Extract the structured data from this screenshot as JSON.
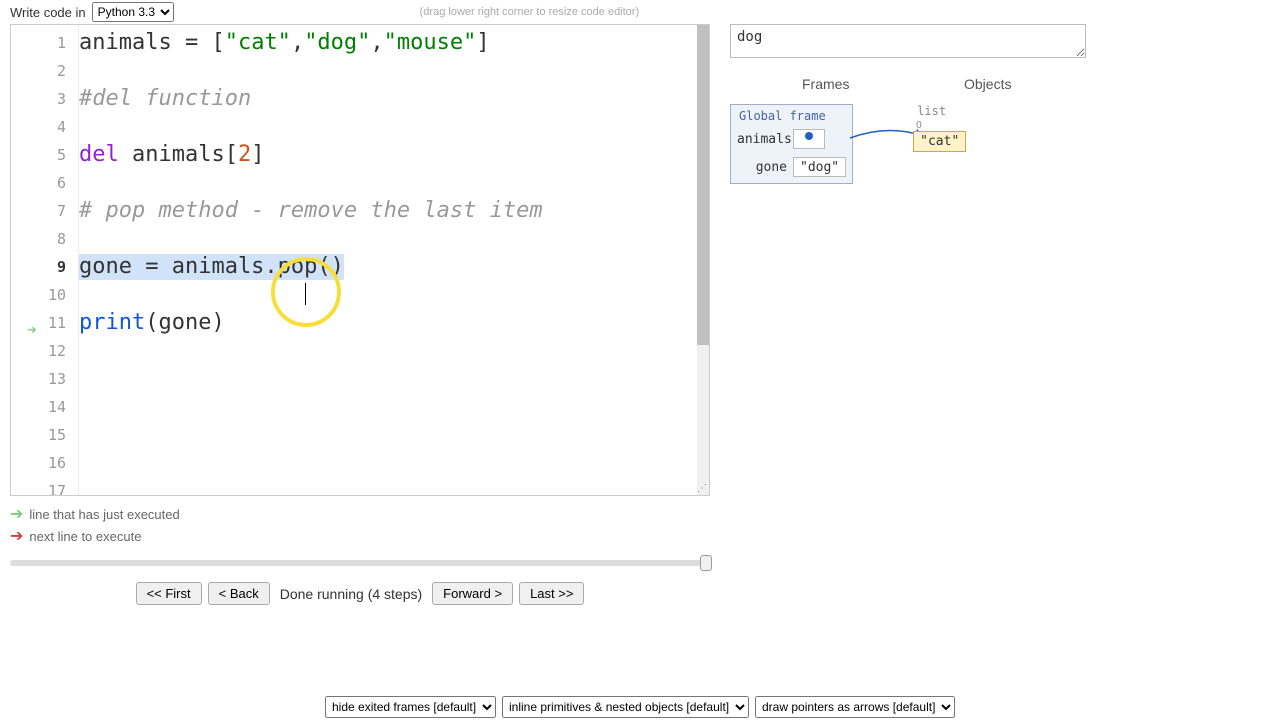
{
  "topbar": {
    "write_label": "Write code in",
    "lang": "Python 3.3",
    "resize_hint": "(drag lower right corner to resize code editor)"
  },
  "code": {
    "lines": [
      {
        "n": 1,
        "tokens": [
          {
            "t": "animals = [",
            "c": ""
          },
          {
            "t": "\"cat\"",
            "c": "str"
          },
          {
            "t": ",",
            "c": ""
          },
          {
            "t": "\"dog\"",
            "c": "str"
          },
          {
            "t": ",",
            "c": ""
          },
          {
            "t": "\"mouse\"",
            "c": "str"
          },
          {
            "t": "]",
            "c": ""
          }
        ]
      },
      {
        "n": 2,
        "tokens": []
      },
      {
        "n": 3,
        "tokens": [
          {
            "t": "#del function",
            "c": "comment"
          }
        ]
      },
      {
        "n": 4,
        "tokens": []
      },
      {
        "n": 5,
        "tokens": [
          {
            "t": "del",
            "c": "kw"
          },
          {
            "t": " animals[",
            "c": ""
          },
          {
            "t": "2",
            "c": "num"
          },
          {
            "t": "]",
            "c": ""
          }
        ]
      },
      {
        "n": 6,
        "tokens": []
      },
      {
        "n": 7,
        "tokens": [
          {
            "t": "# pop method - remove the last item",
            "c": "comment"
          }
        ]
      },
      {
        "n": 8,
        "tokens": []
      },
      {
        "n": 9,
        "tokens": [
          {
            "t": "gone = animals.pop()",
            "c": ""
          }
        ]
      },
      {
        "n": 10,
        "tokens": []
      },
      {
        "n": 11,
        "tokens": [
          {
            "t": "print",
            "c": "builtin"
          },
          {
            "t": "(gone)",
            "c": ""
          }
        ]
      },
      {
        "n": 12,
        "tokens": []
      },
      {
        "n": 13,
        "tokens": []
      },
      {
        "n": 14,
        "tokens": []
      },
      {
        "n": 15,
        "tokens": []
      },
      {
        "n": 16,
        "tokens": []
      },
      {
        "n": 17,
        "tokens": []
      }
    ],
    "highlighted_line": 9,
    "exec_arrow_line": 11
  },
  "legend": {
    "just": "line that has just executed",
    "next": "next line to execute"
  },
  "controls": {
    "first": "<< First",
    "back": "< Back",
    "status": "Done running (4 steps)",
    "forward": "Forward >",
    "last": "Last >>"
  },
  "output": "dog",
  "viz": {
    "frames_label": "Frames",
    "objects_label": "Objects",
    "global_frame": "Global frame",
    "var_animals": "animals",
    "var_gone": "gone",
    "gone_value": "\"dog\"",
    "list_label": "list",
    "list_idx0": "0",
    "list_val0": "\"cat\""
  },
  "bottom": {
    "opt1": "hide exited frames [default]",
    "opt2": "inline primitives & nested objects [default]",
    "opt3": "draw pointers as arrows [default]"
  }
}
